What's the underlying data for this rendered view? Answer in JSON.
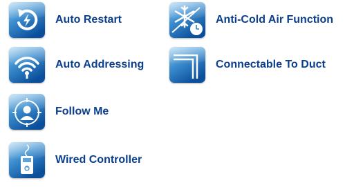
{
  "features": {
    "auto_restart": {
      "label": "Auto Restart",
      "icon": "auto-restart-icon"
    },
    "auto_addressing": {
      "label": "Auto Addressing",
      "icon": "wifi-icon"
    },
    "follow_me": {
      "label": "Follow Me",
      "icon": "person-target-icon"
    },
    "wired_controller": {
      "label": "Wired Controller",
      "icon": "wired-controller-icon"
    },
    "anti_cold_air": {
      "label": "Anti-Cold Air Function",
      "icon": "snowflake-clock-icon"
    },
    "connectable_to_duct": {
      "label": "Connectable To Duct",
      "icon": "duct-icon"
    }
  },
  "colors": {
    "label_text": "#0b3f8c",
    "tile_gradient_top": "#8fc6ea",
    "tile_gradient_bottom": "#0e5aa8"
  }
}
